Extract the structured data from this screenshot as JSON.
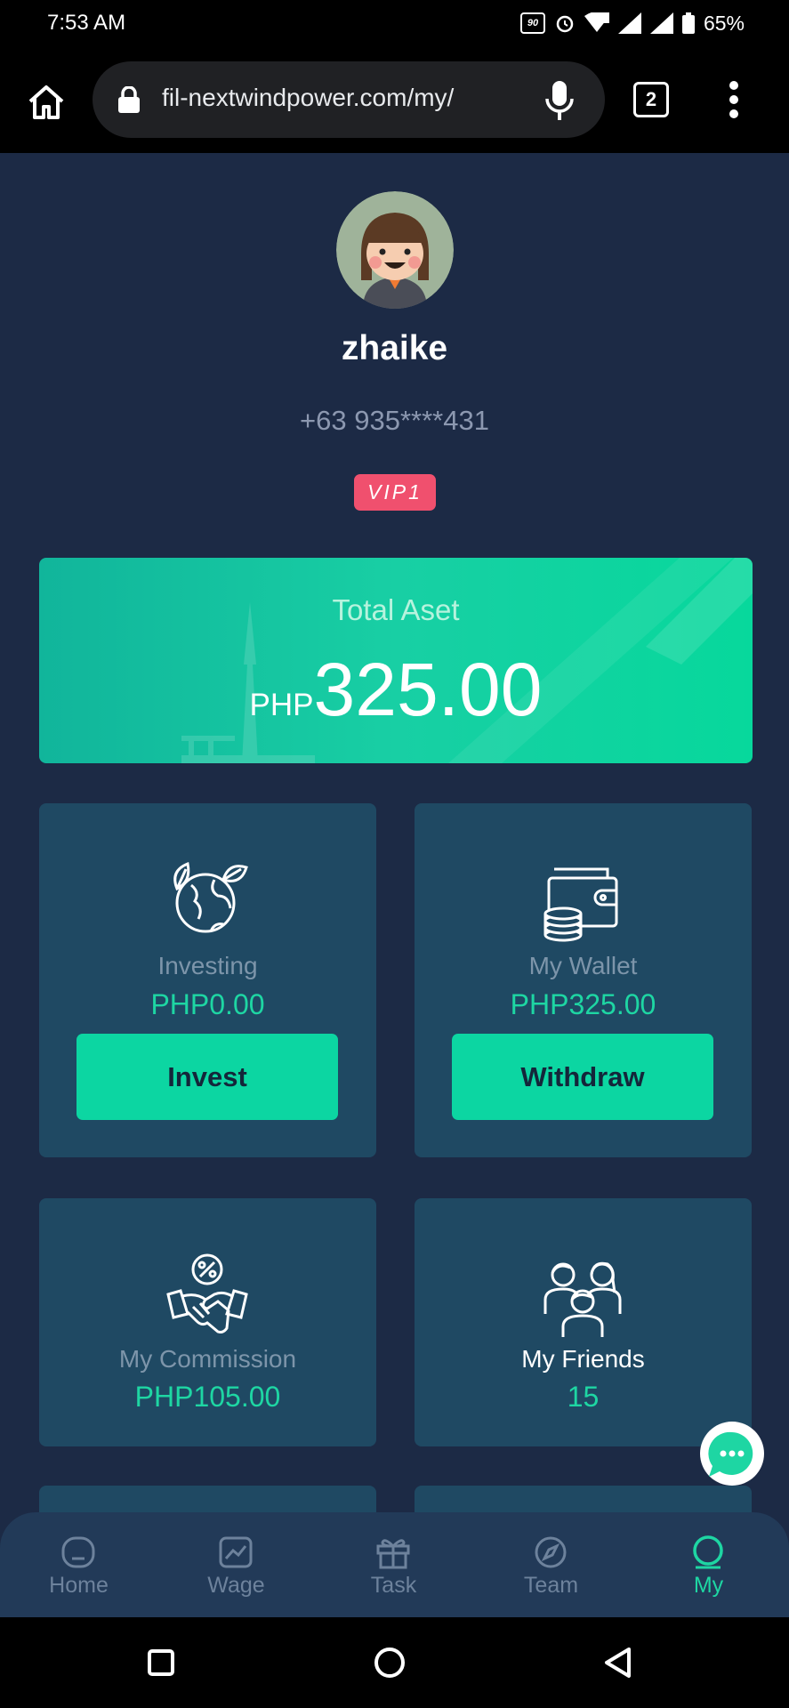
{
  "status_bar": {
    "time": "7:53 AM",
    "battery": "65%",
    "refresh_rate": "90"
  },
  "browser": {
    "url": "fil-nextwindpower.com/my/",
    "tab_count": "2"
  },
  "profile": {
    "username": "zhaike",
    "phone": "+63 935****431",
    "vip_level": "VIP1"
  },
  "total_asset": {
    "label": "Total Aset",
    "currency": "PHP",
    "value": "325.00"
  },
  "cards": {
    "investing": {
      "label": "Investing",
      "value": "PHP0.00",
      "button": "Invest"
    },
    "wallet": {
      "label": "My Wallet",
      "value": "PHP325.00",
      "button": "Withdraw"
    },
    "commission": {
      "label": "My Commission",
      "value": "PHP105.00"
    },
    "friends": {
      "label": "My Friends",
      "value": "15"
    }
  },
  "nav": {
    "items": [
      {
        "label": "Home",
        "icon": "home-icon"
      },
      {
        "label": "Wage",
        "icon": "chart-icon"
      },
      {
        "label": "Task",
        "icon": "gift-icon"
      },
      {
        "label": "Team",
        "icon": "compass-icon"
      },
      {
        "label": "My",
        "icon": "user-circle-icon",
        "active": true
      }
    ]
  },
  "colors": {
    "accent": "#1ed6a3",
    "background": "#1c2a45",
    "card": "#1f4963",
    "vip": "#f0506e"
  }
}
